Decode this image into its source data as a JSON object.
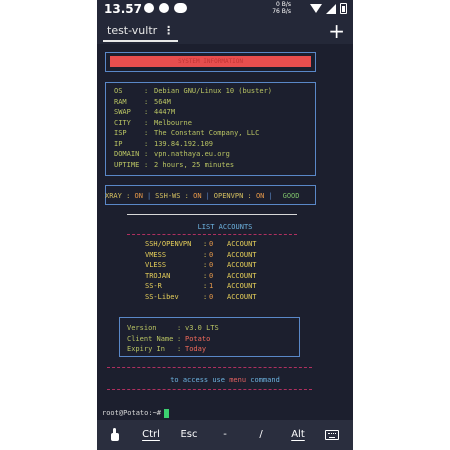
{
  "status_bar": {
    "time": "13.57",
    "net_speed_line1": "0 B/s",
    "net_speed_line2": "76 B/s",
    "icons": [
      "notification-icon",
      "notification-icon",
      "cloud-icon",
      "wifi-icon",
      "signal-icon",
      "battery-icon"
    ]
  },
  "tab": {
    "name": "test-vultr",
    "menu": "⋮",
    "add": "+"
  },
  "banner": {
    "text": "SYSTEM INFORMATION",
    "color": "#e84e4e"
  },
  "system_info": [
    {
      "key": "OS",
      "value": "Debian GNU/Linux 10 (buster)"
    },
    {
      "key": "RAM",
      "value": "564M"
    },
    {
      "key": "SWAP",
      "value": "4447M"
    },
    {
      "key": "CITY",
      "value": "Melbourne"
    },
    {
      "key": "ISP",
      "value": "The Constant Company, LLC"
    },
    {
      "key": "IP",
      "value": "139.84.192.109"
    },
    {
      "key": "DOMAIN",
      "value": "vpn.nathaya.eu.org"
    },
    {
      "key": "UPTIME",
      "value": "2 hours, 25 minutes"
    }
  ],
  "services": {
    "items": [
      {
        "name": "XRAY",
        "state": "ON"
      },
      {
        "name": "SSH-WS",
        "state": "ON"
      },
      {
        "name": "OPENVPN",
        "state": "ON"
      }
    ],
    "overall": "GOOD"
  },
  "accounts": {
    "title": "LIST ACCOUNTS",
    "label": "ACCOUNT",
    "rows": [
      {
        "name": "SSH/OPENVPN",
        "count": "0"
      },
      {
        "name": "VMESS",
        "count": "0"
      },
      {
        "name": "VLESS",
        "count": "0"
      },
      {
        "name": "TROJAN",
        "count": "0"
      },
      {
        "name": "SS-R",
        "count": "1"
      },
      {
        "name": "SS-Libev",
        "count": "0"
      }
    ]
  },
  "script_info": {
    "version_label": "Version",
    "version_value": "v3.0 LTS",
    "client_label": "Client Name",
    "client_value": "Potato",
    "expiry_label": "Expiry In",
    "expiry_value": "Today"
  },
  "hint": {
    "before": "to access use",
    "command": "menu",
    "after": "command"
  },
  "prompt": "root@Potato:~#",
  "extra_keys": [
    "Ctrl",
    "Esc",
    "-",
    "/",
    "Alt"
  ],
  "colors": {
    "terminal_bg": "#1c1f2e",
    "accent_blue": "#5a88c8",
    "cursor": "#3cd070"
  }
}
